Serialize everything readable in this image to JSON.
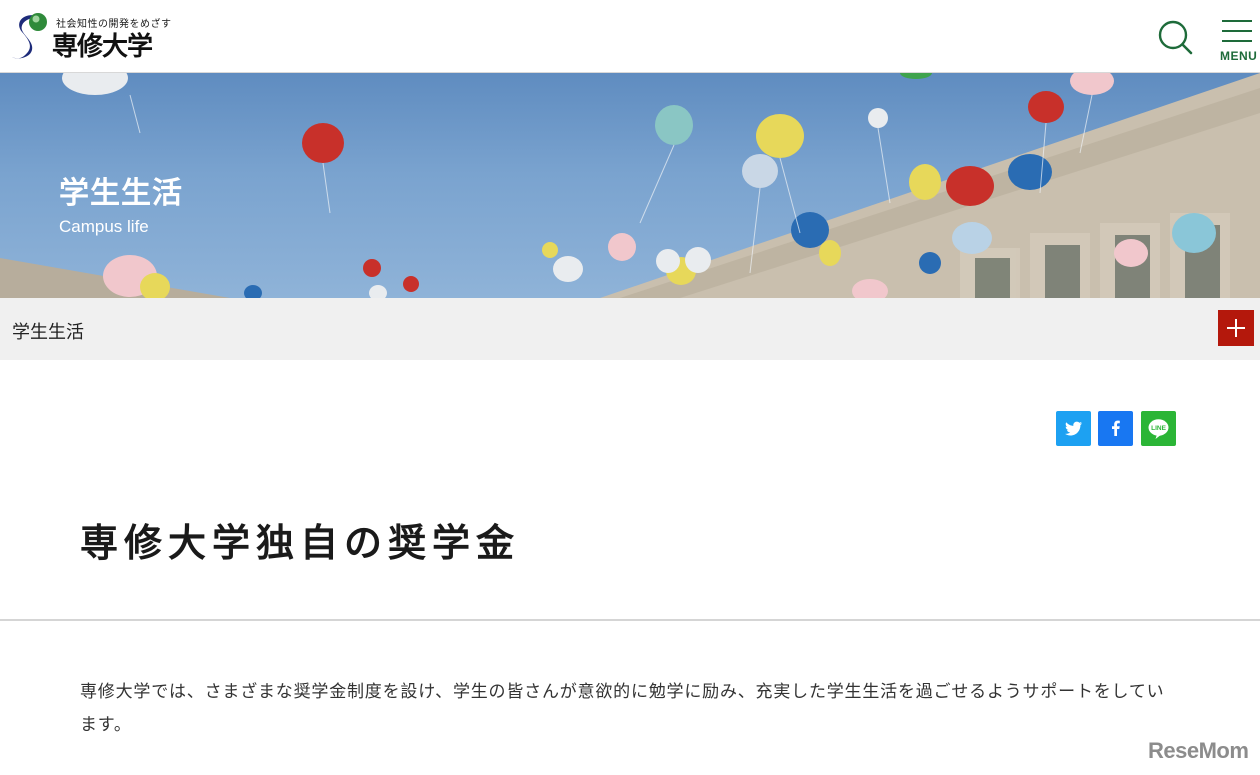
{
  "header": {
    "logo_tagline": "社会知性の開発をめざす",
    "logo_name": "専修大学",
    "menu_label": "MENU"
  },
  "hero": {
    "title": "学生生活",
    "subtitle": "Campus life"
  },
  "breadcrumb": {
    "label": "学生生活"
  },
  "share": {
    "twitter_icon": "twitter-icon",
    "facebook_icon": "facebook-icon",
    "line_icon": "line-icon",
    "line_text": "LINE"
  },
  "main": {
    "title": "専修大学独自の奨学金",
    "intro": "専修大学では、さまざまな奨学金制度を設け、学生の皆さんが意欲的に勉学に励み、充実した学生生活を過ごせるようサポートをしています。"
  },
  "watermark": "ReseMom",
  "colors": {
    "brand_green": "#1e6b3a",
    "toggle_red": "#b4180c",
    "twitter": "#1da1f2",
    "facebook": "#1877f2",
    "line": "#2bb536"
  }
}
